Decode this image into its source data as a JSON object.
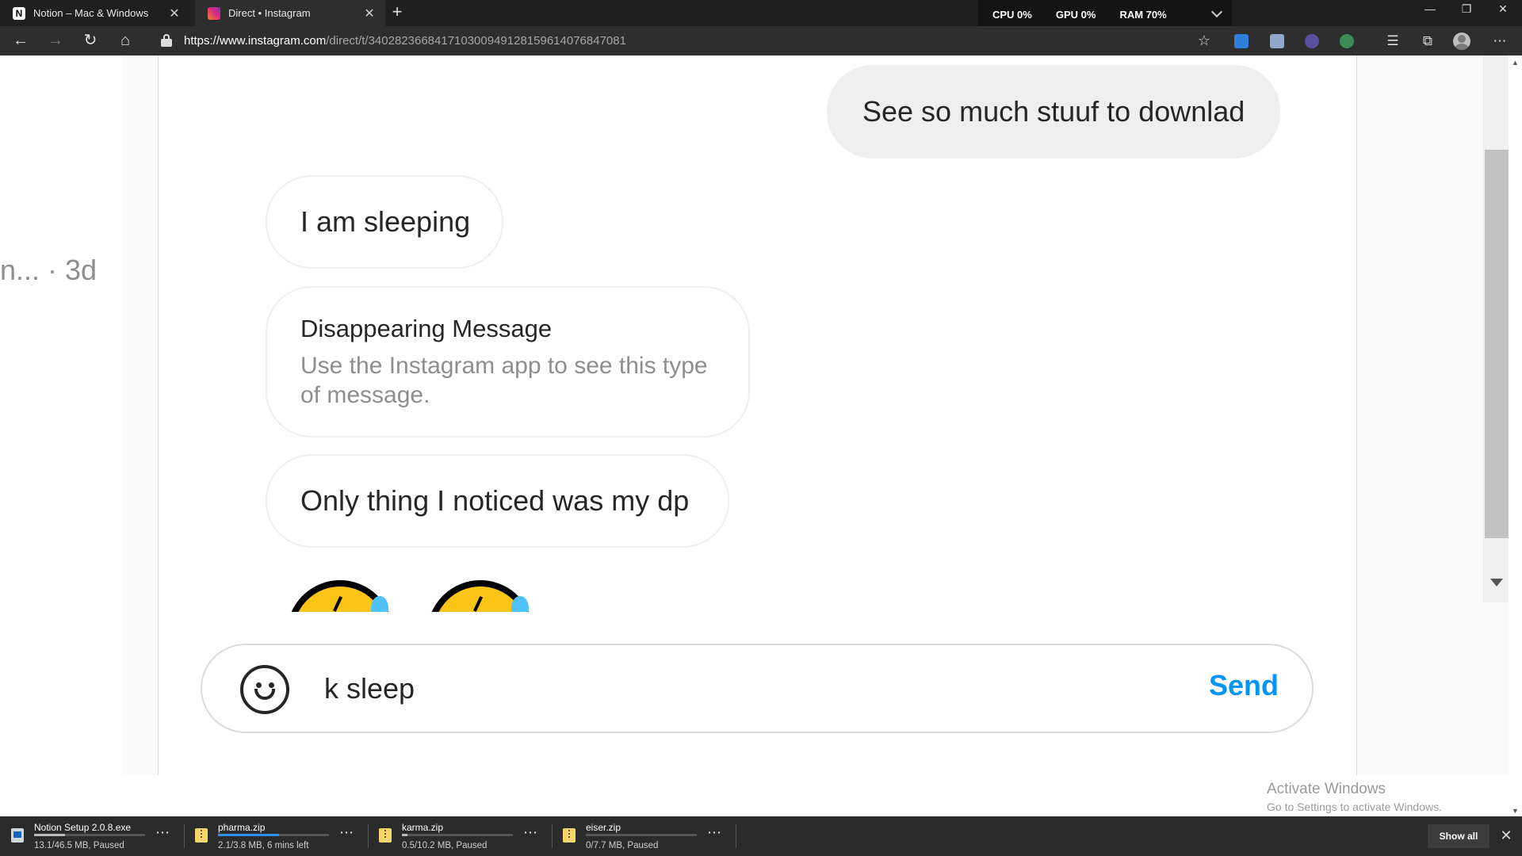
{
  "tabs": [
    {
      "title": "Notion – Mac & Windows",
      "icon": "notion-logo",
      "active": false
    },
    {
      "title": "Direct • Instagram",
      "icon": "instagram-logo",
      "active": true
    }
  ],
  "perf": {
    "cpu": "CPU  0%",
    "gpu": "GPU  0%",
    "ram": "RAM  70%"
  },
  "address": {
    "host": "https://www.instagram.com",
    "path": "/direct/t/340282366841710300949128159614076847081"
  },
  "sidebar": {
    "snippet": "n... · 3d"
  },
  "messages": [
    {
      "sender": "me",
      "text": "See so much stuuf to downlad"
    },
    {
      "sender": "them",
      "text": "I am sleeping"
    },
    {
      "sender": "them",
      "type": "disappearing",
      "title": "Disappearing Message",
      "body": "Use the Instagram app to see this type of message."
    },
    {
      "sender": "them",
      "text": "Only thing I noticed was my dp"
    }
  ],
  "emojis": [
    "crying-laughing-emoji",
    "crying-laughing-emoji"
  ],
  "composer": {
    "value": "k sleep",
    "send_label": "Send"
  },
  "watermark": {
    "line1": "Activate Windows",
    "line2": "Go to Settings to activate Windows."
  },
  "downloads": [
    {
      "name": "Notion Setup 2.0.8.exe",
      "status": "13.1/46.5 MB, Paused",
      "progress": 0.28,
      "active": false
    },
    {
      "name": "pharma.zip",
      "status": "2.1/3.8 MB, 6 mins left",
      "progress": 0.55,
      "active": true
    },
    {
      "name": "karma.zip",
      "status": "0.5/10.2 MB, Paused",
      "progress": 0.05,
      "active": false
    },
    {
      "name": "eiser.zip",
      "status": "0/7.7 MB, Paused",
      "progress": 0.0,
      "active": false
    }
  ],
  "downloads_bar": {
    "show_all": "Show all"
  },
  "colors": {
    "accent": "#0095f6",
    "my_bubble": "#efefef",
    "chrome_dark": "#2e2e2e"
  }
}
